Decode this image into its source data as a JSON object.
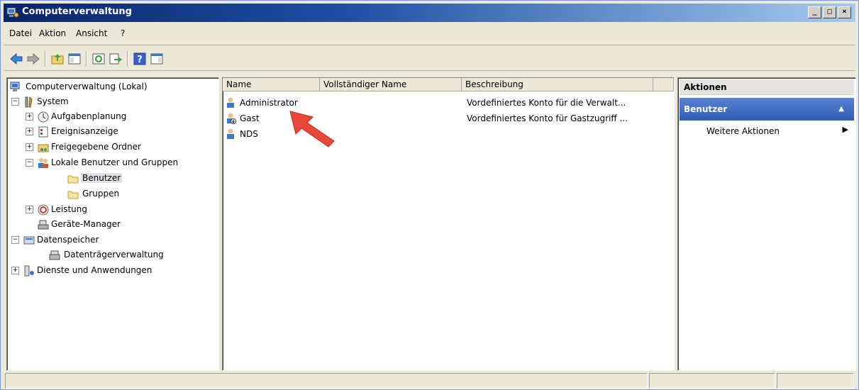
{
  "window": {
    "title": "Computerverwaltung",
    "controls": [
      "_",
      "□",
      "×"
    ]
  },
  "menu": [
    "Datei",
    "Aktion",
    "Ansicht",
    "?"
  ],
  "tree": {
    "root": "Computerverwaltung (Lokal)",
    "system": "System",
    "aufgaben": "Aufgabenplanung",
    "ereignis": "Ereignisanzeige",
    "freigabe": "Freigegebene Ordner",
    "lokale": "Lokale Benutzer und Gruppen",
    "benutzer": "Benutzer",
    "gruppen": "Gruppen",
    "leistung": "Leistung",
    "geraete": "Geräte-Manager",
    "datenspeicher": "Datenspeicher",
    "datentraeger": "Datenträgerverwaltung",
    "dienste": "Dienste und Anwendungen"
  },
  "list": {
    "columns": [
      "Name",
      "Vollständiger Name",
      "Beschreibung"
    ],
    "rows": [
      {
        "name": "Administrator",
        "fullname": "",
        "description": "Vordefiniertes Konto für die Verwalt..."
      },
      {
        "name": "Gast",
        "fullname": "",
        "description": "Vordefiniertes Konto für Gastzugriff ..."
      },
      {
        "name": "NDS",
        "fullname": "",
        "description": ""
      }
    ]
  },
  "actions": {
    "header": "Aktionen",
    "section": "Benutzer",
    "item": "Weitere Aktionen"
  },
  "colors": {
    "titlebar": "#0a246a",
    "section": "#2e5cb8",
    "arrow": "#e8473a"
  }
}
